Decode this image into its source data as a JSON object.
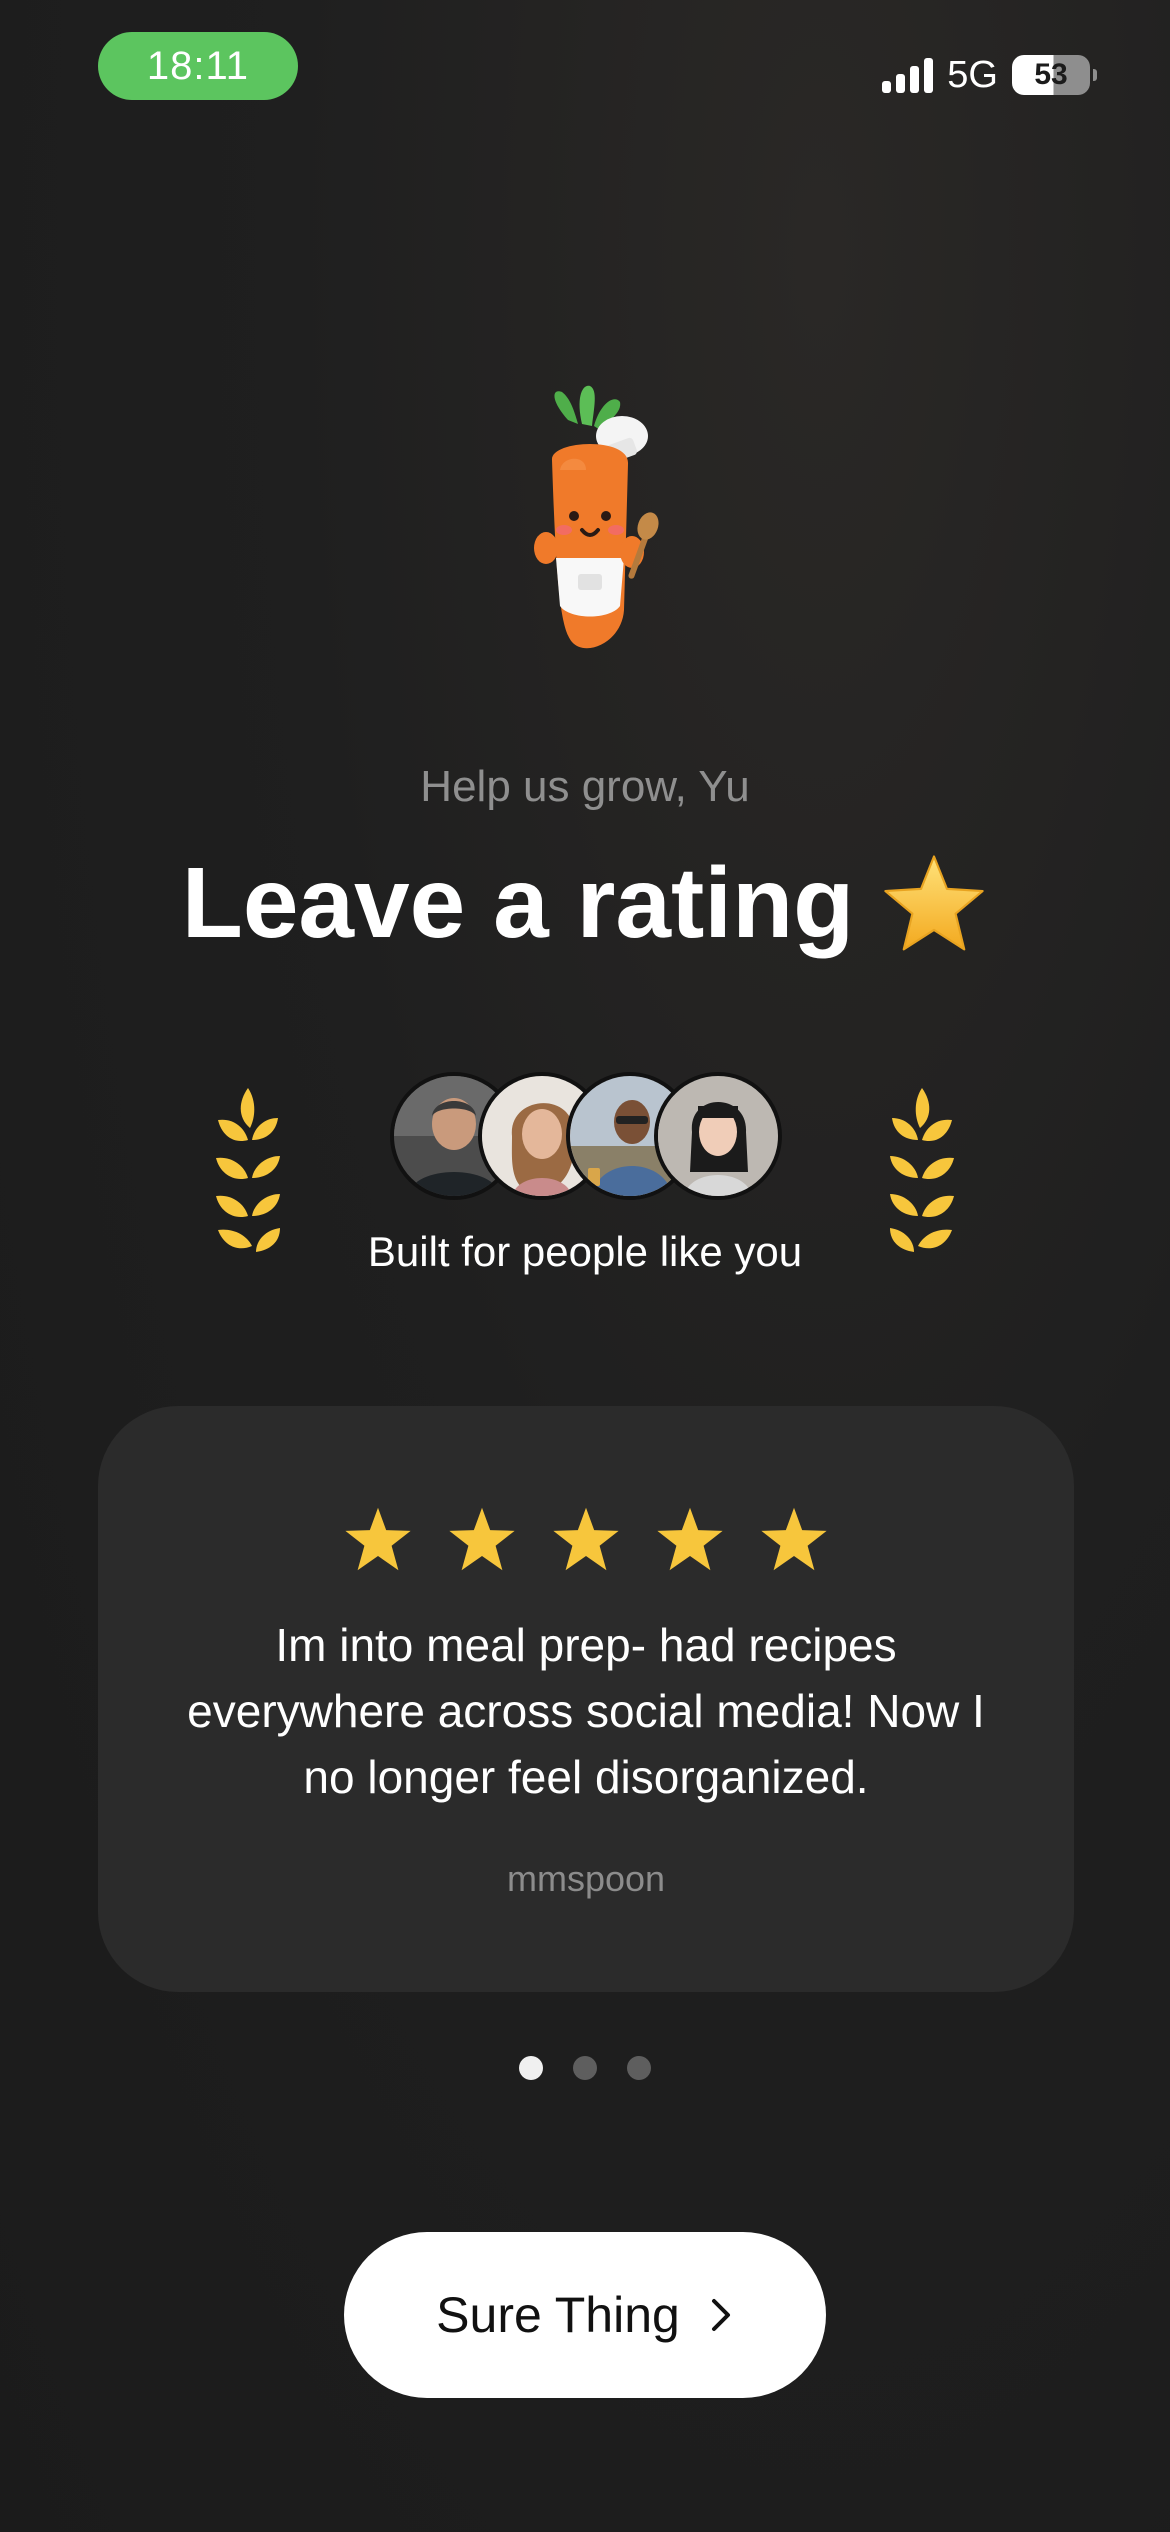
{
  "status_bar": {
    "time": "18:11",
    "network": "5G",
    "battery": "53"
  },
  "header": {
    "subtitle": "Help us grow, Yu",
    "title": "Leave a rating"
  },
  "social_proof": {
    "label": "Built for people like you",
    "avatars": [
      "avatar-man-1",
      "avatar-woman-1",
      "avatar-man-2",
      "avatar-woman-2"
    ]
  },
  "review_card": {
    "rating": 5,
    "text": "Im into meal prep- had recipes everywhere across social media! Now I no longer feel disorganized.",
    "author": "mmspoon"
  },
  "pagination": {
    "total": 3,
    "active": 0
  },
  "cta": {
    "label": "Sure Thing"
  },
  "colors": {
    "background": "#1c1c1c",
    "card": "#2b2b2b",
    "star": "#f7c63c",
    "time_pill": "#5cc55f",
    "button": "#ffffff"
  }
}
